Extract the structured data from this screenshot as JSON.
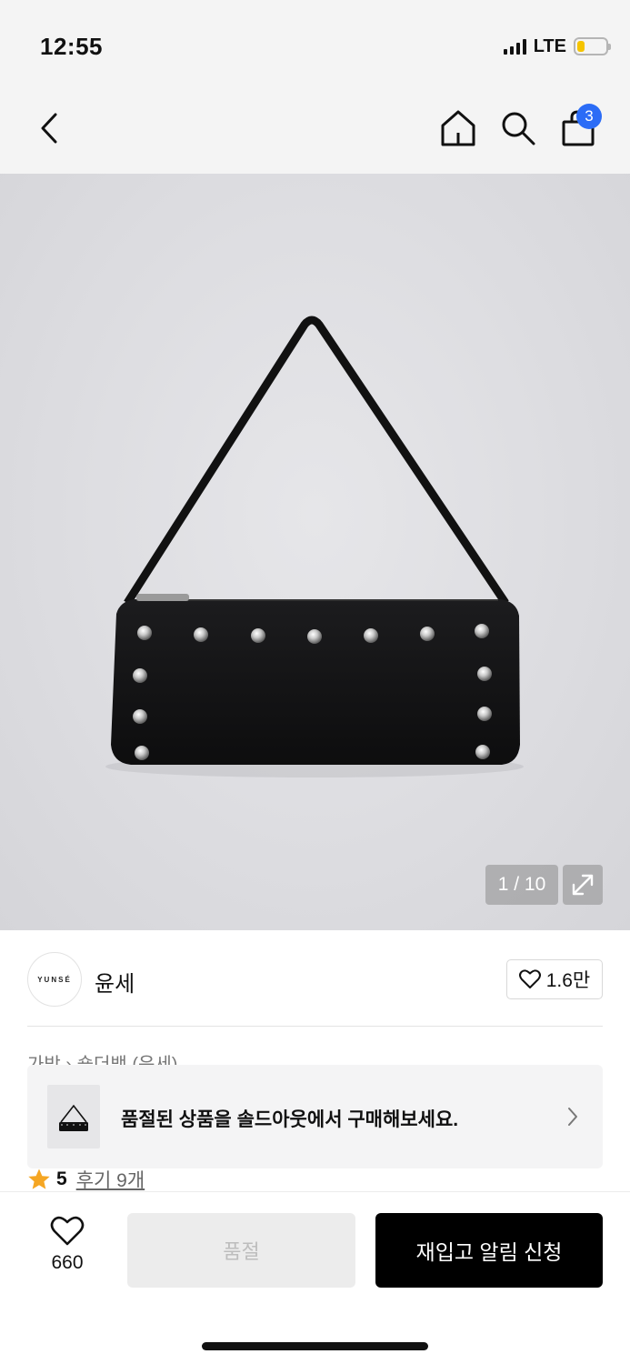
{
  "status_bar": {
    "time": "12:55",
    "network": "LTE",
    "battery_level": 0.25,
    "battery_color": "#f5c400"
  },
  "nav": {
    "back_icon": "chevron-left-icon",
    "home_icon": "home-icon",
    "search_icon": "search-icon",
    "cart_icon": "shopping-bag-icon",
    "cart_count": "3",
    "badge_color": "#2b6cf6"
  },
  "gallery": {
    "counter": "1 / 10",
    "expand_icon": "expand-icon"
  },
  "brand": {
    "logo_text": "YUNSÉ",
    "name": "윤세",
    "like_count": "1.6만"
  },
  "breadcrumb": "가방 › 숄더백 (윤세)",
  "soldout_banner": {
    "text": "품절된 상품을 솔드아웃에서 구매해보세요.",
    "arrow_icon": "chevron-right-icon"
  },
  "rating": {
    "score": "5",
    "review_link": "후기 9개",
    "star_color": "#f5a623"
  },
  "bottom": {
    "wish_count": "660",
    "soldout_label": "품절",
    "restock_label": "재입고 알림 신청"
  }
}
